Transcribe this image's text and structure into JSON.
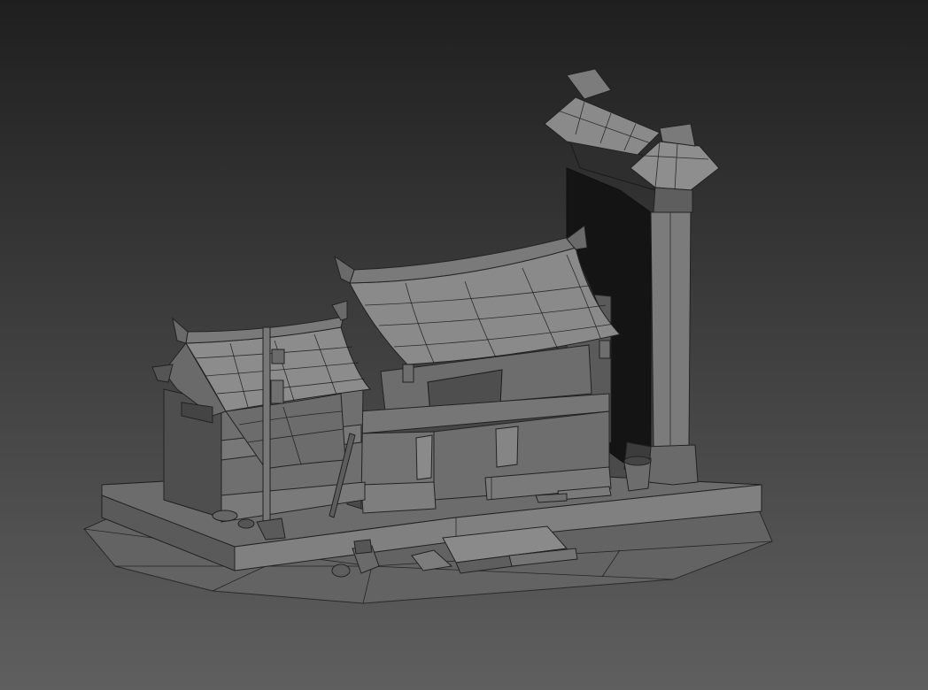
{
  "viewport": {
    "background_top": "#1f1f1f",
    "background_bottom": "#5f5f5f",
    "shading": {
      "light": "#8e8e8e",
      "mid": "#6f6f6f",
      "dark": "#4a4a4a",
      "shadow": "#1a1a1a",
      "wire": "#1a1a1a"
    }
  },
  "scene": {
    "objects": [
      "ground-base-icon",
      "left-building-icon",
      "main-building-icon",
      "tall-gate-tower-icon",
      "lamp-post-icon",
      "bucket-icon",
      "wooden-planks-icon",
      "stone-debris-icon",
      "leaning-stick-icon"
    ]
  }
}
